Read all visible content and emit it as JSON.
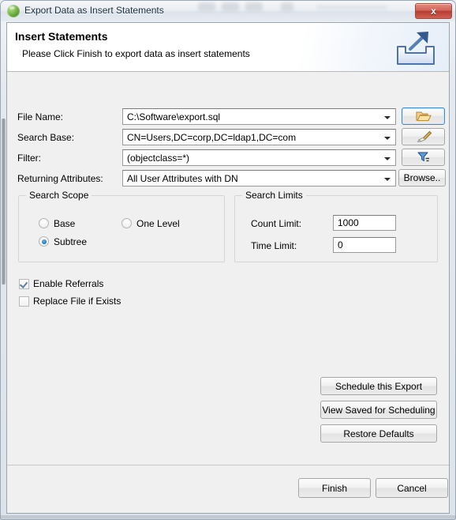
{
  "window": {
    "title": "Export Data as Insert Statements",
    "title_icon": "green-sphere-icon",
    "close_label": "x"
  },
  "banner": {
    "title": "Insert Statements",
    "subtitle": "Please Click Finish to export data as insert statements",
    "icon": "export-tray-arrow-icon"
  },
  "fields": [
    {
      "label": "File Name:",
      "value": "C:\\Software\\export.sql",
      "side_button": "open-folder-icon"
    },
    {
      "label": "Search Base:",
      "value": "CN=Users,DC=corp,DC=ldap1,DC=com",
      "side_button": "pen-picker-icon"
    },
    {
      "label": "Filter:",
      "value": "(objectclass=*)",
      "side_button": "filter-funnel-icon"
    },
    {
      "label": "Returning Attributes:",
      "value": "All User Attributes with DN",
      "side_button": "Browse.."
    }
  ],
  "search_scope": {
    "title": "Search Scope",
    "options": [
      {
        "label": "Base",
        "selected": false
      },
      {
        "label": "One Level",
        "selected": false
      },
      {
        "label": "Subtree",
        "selected": true
      }
    ]
  },
  "search_limits": {
    "title": "Search Limits",
    "count_limit_label": "Count Limit:",
    "count_limit_value": "1000",
    "time_limit_label": "Time Limit:",
    "time_limit_value": "0"
  },
  "checkboxes": [
    {
      "label": "Enable Referrals",
      "checked": true
    },
    {
      "label": "Replace File if Exists",
      "checked": false
    }
  ],
  "actions": [
    {
      "label": "Schedule this Export"
    },
    {
      "label": "View Saved for Scheduling"
    },
    {
      "label": "Restore Defaults"
    }
  ],
  "footer": {
    "finish_label": "Finish",
    "cancel_label": "Cancel"
  },
  "colors": {
    "accent_blue": "#2d7fc4",
    "close_red": "#b63d30",
    "folder_orange": "#e8a33d",
    "banner_icon_blue": "#5b84bd",
    "client_bg": "#f0f0f0"
  }
}
